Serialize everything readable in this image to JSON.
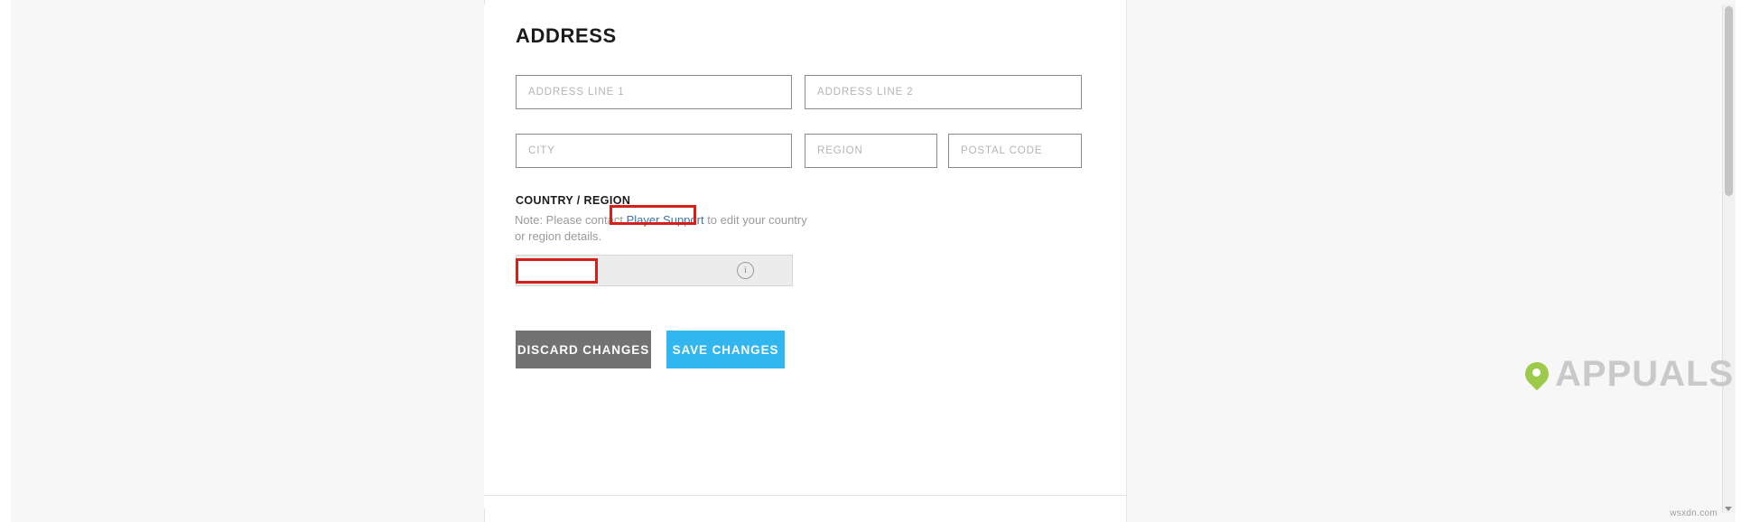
{
  "section": {
    "title": "ADDRESS"
  },
  "fields": {
    "address_line_1": {
      "placeholder": "ADDRESS LINE 1",
      "value": ""
    },
    "address_line_2": {
      "placeholder": "ADDRESS LINE 2",
      "value": ""
    },
    "city": {
      "placeholder": "CITY",
      "value": ""
    },
    "region": {
      "placeholder": "REGION",
      "value": ""
    },
    "postal_code": {
      "placeholder": "POSTAL CODE",
      "value": ""
    }
  },
  "country_region": {
    "label": "COUNTRY / REGION",
    "note_prefix": "Note: Please contact ",
    "note_link": "Player Support",
    "note_suffix": " to edit your country or region details.",
    "select_value": "",
    "info_icon": "info-icon",
    "disabled": true
  },
  "buttons": {
    "discard": "DISCARD CHANGES",
    "save": "SAVE CHANGES"
  },
  "annotations": {
    "link_highlight": "Player Support",
    "field_highlight": "country-select",
    "color": "#d61f18"
  },
  "watermark": {
    "text": "APPUALS",
    "credit": "wsxdn.com"
  },
  "colors": {
    "save_button": "#31b6ef",
    "discard_button": "#727272",
    "link": "#3b73a8",
    "placeholder": "#b4b4b4",
    "disabled_field": "#ececec"
  }
}
